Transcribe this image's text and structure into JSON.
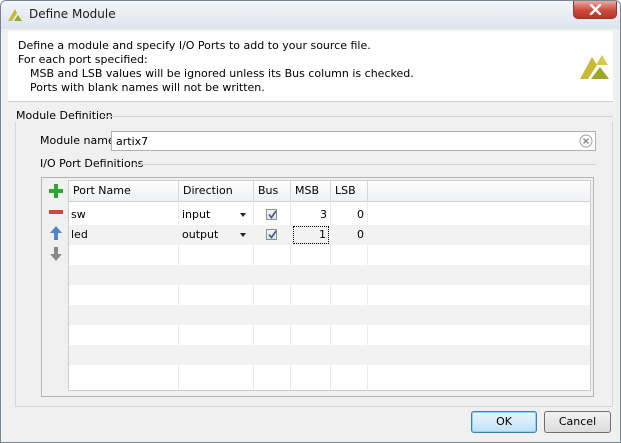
{
  "window": {
    "title": "Define Module"
  },
  "header": {
    "line1": "Define a module and specify I/O Ports to add to your source file.",
    "line2": "For each port specified:",
    "line3": "MSB and LSB values will be ignored unless its Bus column is checked.",
    "line4": "Ports with blank names will not be written."
  },
  "module_definition": {
    "section_title": "Module Definition",
    "name_label": "Module name:",
    "name_value": "artix7"
  },
  "ports": {
    "section_title": "I/O Port Definitions",
    "columns": [
      "Port Name",
      "Direction",
      "Bus",
      "MSB",
      "LSB"
    ],
    "rows": [
      {
        "name": "sw",
        "direction": "input",
        "bus": true,
        "msb": "3",
        "lsb": "0"
      },
      {
        "name": "led",
        "direction": "output",
        "bus": true,
        "msb": "1",
        "lsb": "0"
      }
    ],
    "side_buttons": [
      "add-icon",
      "remove-icon",
      "move-up-icon",
      "move-down-icon"
    ]
  },
  "buttons": {
    "ok": "OK",
    "cancel": "Cancel"
  },
  "colors": {
    "add_green": "#2ea52e",
    "remove_red": "#c94a3d",
    "arrow_blue": "#4f86c6",
    "accent_blue": "#3c7fb1"
  }
}
